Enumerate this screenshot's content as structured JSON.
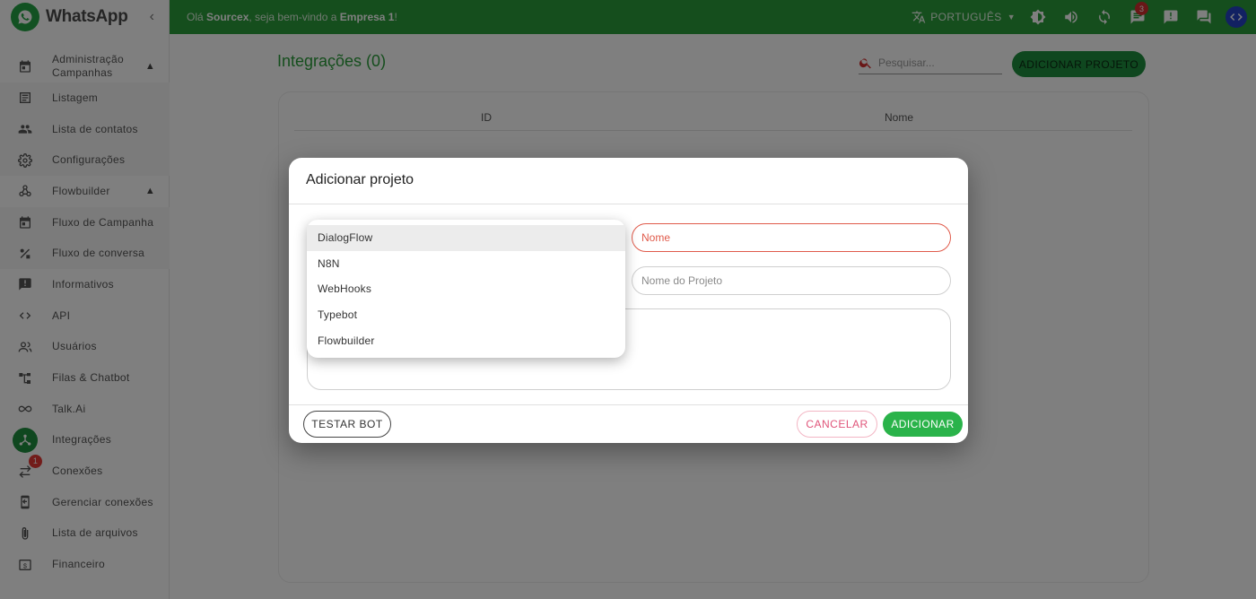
{
  "app": {
    "name": "WhatsApp"
  },
  "topbar": {
    "greeting_prefix": "Olá ",
    "user": "Sourcex",
    "greeting_middle": ", seja bem-vindo a ",
    "company": "Empresa 1",
    "greeting_suffix": "!",
    "language": "PORTUGUÊS",
    "chat_badge": "3"
  },
  "sidebar": {
    "items": [
      {
        "label": "Administração Campanhas",
        "icon": "calendar-icon"
      },
      {
        "label": "Listagem",
        "icon": "list-icon"
      },
      {
        "label": "Lista de contatos",
        "icon": "people-icon"
      },
      {
        "label": "Configurações",
        "icon": "gear-icon"
      },
      {
        "label": "Flowbuilder",
        "icon": "webhook-icon"
      },
      {
        "label": "Fluxo de Campanha",
        "icon": "calendar-icon"
      },
      {
        "label": "Fluxo de conversa",
        "icon": "shapes-icon"
      },
      {
        "label": "Informativos",
        "icon": "announcement-icon"
      },
      {
        "label": "API",
        "icon": "code-icon"
      },
      {
        "label": "Usuários",
        "icon": "users-icon"
      },
      {
        "label": "Filas & Chatbot",
        "icon": "tree-icon"
      },
      {
        "label": "Talk.Ai",
        "icon": "infinity-icon"
      },
      {
        "label": "Integrações",
        "icon": "integration-icon"
      },
      {
        "label": "Conexões",
        "icon": "swap-icon",
        "badge": "1"
      },
      {
        "label": "Gerenciar conexões",
        "icon": "device-icon"
      },
      {
        "label": "Lista de arquivos",
        "icon": "paperclip-icon"
      },
      {
        "label": "Financeiro",
        "icon": "money-icon"
      }
    ]
  },
  "page": {
    "title": "Integrações (0)",
    "search_placeholder": "Pesquisar...",
    "add_button": "ADICIONAR PROJETO",
    "columns": [
      "ID",
      "Nome"
    ]
  },
  "dialog": {
    "title": "Adicionar projeto",
    "options": [
      "DialogFlow",
      "N8N",
      "WebHooks",
      "Typebot",
      "Flowbuilder"
    ],
    "selected_option": "DialogFlow",
    "name_placeholder": "Nome",
    "project_placeholder": "Nome do Projeto",
    "test_button": "TESTAR BOT",
    "cancel_button": "CANCELAR",
    "add_button": "ADICIONAR"
  },
  "colors": {
    "brand_green": "#2a9d3a",
    "accent_green": "#1e8e3e",
    "error": "#e05a4a",
    "cancel": "#e0557a"
  }
}
